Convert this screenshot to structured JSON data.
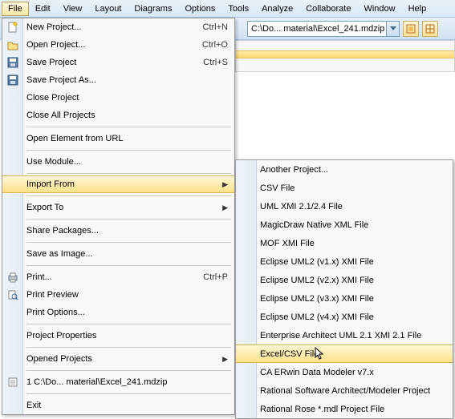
{
  "menubar": {
    "items": [
      "File",
      "Edit",
      "View",
      "Layout",
      "Diagrams",
      "Options",
      "Tools",
      "Analyze",
      "Collaborate",
      "Window",
      "Help"
    ],
    "active_index": 0
  },
  "toolbar": {
    "path_value": "C:\\Do... material\\Excel_241.mdzip"
  },
  "file_menu": {
    "items": [
      {
        "label": "New Project...",
        "accel": "Ctrl+N",
        "icon": "new"
      },
      {
        "label": "Open Project...",
        "accel": "Ctrl+O",
        "icon": "open"
      },
      {
        "label": "Save Project",
        "accel": "Ctrl+S",
        "icon": "save"
      },
      {
        "label": "Save Project As...",
        "accel": "",
        "icon": "saveas"
      },
      {
        "label": "Close Project",
        "accel": "",
        "icon": ""
      },
      {
        "label": "Close All Projects",
        "accel": "",
        "icon": ""
      },
      {
        "sep": true
      },
      {
        "label": "Open Element from URL",
        "accel": "",
        "icon": ""
      },
      {
        "sep": true
      },
      {
        "label": "Use Module...",
        "accel": "",
        "icon": ""
      },
      {
        "sep": true
      },
      {
        "label": "Import From",
        "accel": "",
        "icon": "",
        "submenu": true,
        "hi": true
      },
      {
        "sep": true
      },
      {
        "label": "Export To",
        "accel": "",
        "icon": "",
        "submenu": true
      },
      {
        "sep": true
      },
      {
        "label": "Share Packages...",
        "accel": "",
        "icon": ""
      },
      {
        "sep": true
      },
      {
        "label": "Save as Image...",
        "accel": "",
        "icon": ""
      },
      {
        "sep": true
      },
      {
        "label": "Print...",
        "accel": "Ctrl+P",
        "icon": "print"
      },
      {
        "label": "Print Preview",
        "accel": "",
        "icon": "preview"
      },
      {
        "label": "Print Options...",
        "accel": "",
        "icon": ""
      },
      {
        "sep": true
      },
      {
        "label": "Project Properties",
        "accel": "",
        "icon": ""
      },
      {
        "sep": true
      },
      {
        "label": "Opened Projects",
        "accel": "",
        "icon": "",
        "submenu": true
      },
      {
        "sep": true
      },
      {
        "label": "1 C:\\Do... material\\Excel_241.mdzip",
        "accel": "",
        "icon": "recent"
      },
      {
        "sep": true
      },
      {
        "label": "Exit",
        "accel": "",
        "icon": ""
      }
    ]
  },
  "import_submenu": {
    "items": [
      {
        "label": "Another Project..."
      },
      {
        "label": "CSV File"
      },
      {
        "label": "UML XMI 2.1/2.4 File"
      },
      {
        "label": "MagicDraw Native XML File"
      },
      {
        "label": "MOF XMI File"
      },
      {
        "label": "Eclipse UML2 (v1.x) XMI File"
      },
      {
        "label": "Eclipse UML2 (v2.x) XMI File"
      },
      {
        "label": "Eclipse UML2 (v3.x) XMI File"
      },
      {
        "label": "Eclipse UML2 (v4.x) XMI File"
      },
      {
        "label": "Enterprise Architect UML 2.1 XMI 2.1 File"
      },
      {
        "label": "Excel/CSV File",
        "hi": true
      },
      {
        "label": "CA ERwin Data Modeler v7.x"
      },
      {
        "label": "Rational Software Architect/Modeler Project"
      },
      {
        "label": "Rational Rose *.mdl Project File"
      }
    ]
  }
}
